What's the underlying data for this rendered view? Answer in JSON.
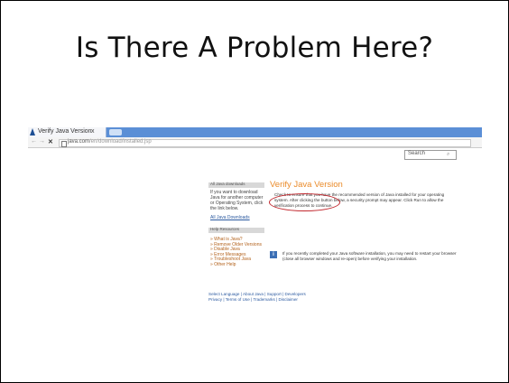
{
  "slide": {
    "title": "Is There A Problem Here?"
  },
  "browser": {
    "tab_title": "Verify Java Version",
    "tab_close": "x",
    "url_domain": "java.com",
    "url_path": "/en/download/installed.jsp"
  },
  "page": {
    "search_label": "Search",
    "sidebar": {
      "section1_heading": "All Java downloads",
      "section1_text": "If you want to download Java for another computer or Operating System, click the link below.",
      "section1_link": "All Java Downloads",
      "section2_heading": "Help Resources",
      "links": [
        "» What is Java?",
        "» Remove Older Versions",
        "» Disable Java",
        "» Error Messages",
        "» Troubleshoot Java",
        "» Other Help"
      ]
    },
    "main": {
      "title": "Verify Java Version",
      "text": "Check to ensure that you have the recommended version of Java installed for your operating system. After clicking the button below, a security prompt may appear. Click Run to allow the verification process to continue.",
      "info_icon": "i",
      "info_text": "If you recently completed your Java software installation, you may need to restart your browser (close all browser windows and re-open) before verifying your installation."
    },
    "footer": {
      "line1": "Select Language | About Java | Support | Developers",
      "line2": "Privacy | Terms of Use | Trademarks | Disclaimer"
    }
  }
}
